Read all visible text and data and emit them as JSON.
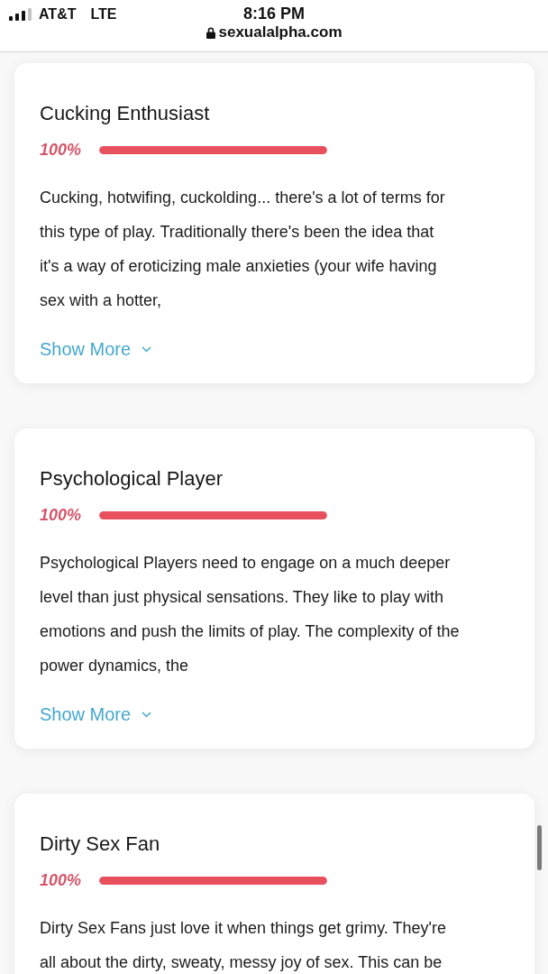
{
  "status_bar": {
    "carrier": "AT&T",
    "network": "LTE",
    "time": "8:16 PM",
    "url": "sexualalpha.com"
  },
  "results": [
    {
      "title": "Cucking Enthusiast",
      "percent": "100%",
      "level": 1,
      "description": "Cucking, hotwifing, cuckolding... there's a lot of terms for\nthis type of play. Traditionally there's been the idea that\nit's a way of eroticizing male anxieties (your wife having\nsex with a hotter,",
      "link": "Show More"
    },
    {
      "title": "Psychological Player",
      "percent": "100%",
      "level": 1,
      "description": "Psychological Players need to engage on a much deeper\nlevel than just physical sensations. They like to play with\nemotions and push the limits of play. The complexity of the\npower dynamics, the",
      "link": "Show More"
    },
    {
      "title": "Dirty Sex Fan",
      "percent": "100%",
      "level": 1,
      "description": "Dirty Sex Fans just love it when things get grimy. They're\nall about the dirty, sweaty, messy joy of sex. This can be"
    }
  ]
}
